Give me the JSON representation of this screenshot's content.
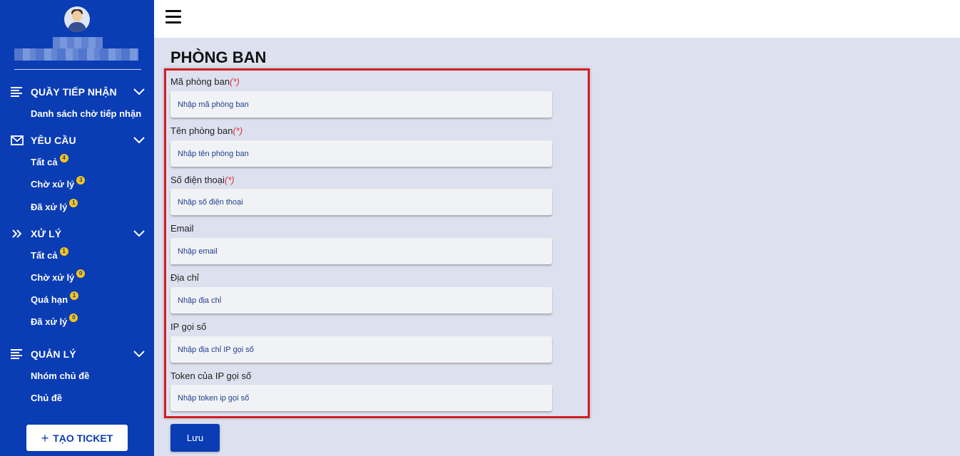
{
  "sidebar": {
    "sections": [
      {
        "title": "QUẦY TIẾP NHẬN",
        "icon": "list-icon",
        "items": [
          {
            "label": "Danh sách chờ tiếp nhận",
            "badge": null
          }
        ]
      },
      {
        "title": "YÊU CẦU",
        "icon": "envelope-icon",
        "items": [
          {
            "label": "Tất cả",
            "badge": "4"
          },
          {
            "label": "Chờ xử lý",
            "badge": "3"
          },
          {
            "label": "Đã xử lý",
            "badge": "1"
          }
        ]
      },
      {
        "title": "XỬ LÝ",
        "icon": "double-chevron-right-icon",
        "items": [
          {
            "label": "Tất cả",
            "badge": "1"
          },
          {
            "label": "Chờ xử lý",
            "badge": "0"
          },
          {
            "label": "Quá hạn",
            "badge": "1"
          },
          {
            "label": "Đã xử lý",
            "badge": "0"
          }
        ]
      },
      {
        "title": "QUẢN LÝ",
        "icon": "list-icon",
        "items": [
          {
            "label": "Nhóm chủ đề",
            "badge": null
          },
          {
            "label": "Chủ đề",
            "badge": null
          }
        ]
      }
    ],
    "create_button": "TẠO TICKET"
  },
  "page": {
    "title": "PHÒNG BAN",
    "required_mark": "(*)",
    "fields": [
      {
        "label": "Mã phòng ban",
        "required": true,
        "placeholder": "Nhập mã phòng ban",
        "value": ""
      },
      {
        "label": "Tên phòng ban",
        "required": true,
        "placeholder": "Nhập tên phòng ban",
        "value": ""
      },
      {
        "label": "Số điện thoại",
        "required": true,
        "placeholder": "Nhập số điện thoại",
        "value": ""
      },
      {
        "label": "Email",
        "required": false,
        "placeholder": "Nhập email",
        "value": ""
      },
      {
        "label": "Địa chỉ",
        "required": false,
        "placeholder": "Nhập địa chỉ",
        "value": ""
      },
      {
        "label": "IP gọi số",
        "required": false,
        "placeholder": "Nhập địa chỉ IP gọi số",
        "value": ""
      },
      {
        "label": "Token của IP gọi số",
        "required": false,
        "placeholder": "Nhập token ip gọi số",
        "value": ""
      }
    ],
    "save_button": "Lưu"
  },
  "colors": {
    "sidebar": "#0a3cb4",
    "badge": "#f5c518",
    "highlight_border": "#d21f1f",
    "background": "#dde1ef"
  }
}
